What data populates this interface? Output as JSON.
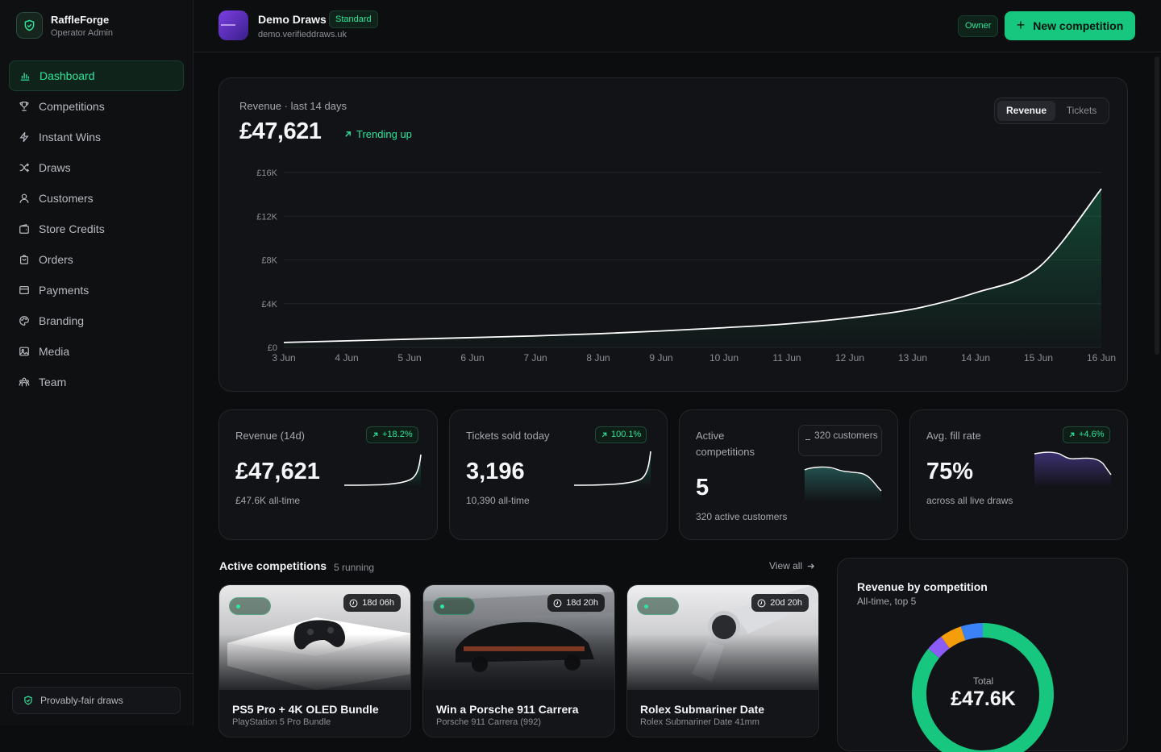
{
  "brand": {
    "name": "RaffleForge",
    "role": "Operator Admin"
  },
  "nav": [
    {
      "label": "Dashboard",
      "icon": "bar-chart-icon",
      "active": true
    },
    {
      "label": "Competitions",
      "icon": "trophy-icon"
    },
    {
      "label": "Instant Wins",
      "icon": "lightning-icon"
    },
    {
      "label": "Draws",
      "icon": "shuffle-icon"
    },
    {
      "label": "Customers",
      "icon": "user-icon"
    },
    {
      "label": "Store Credits",
      "icon": "wallet-icon"
    },
    {
      "label": "Orders",
      "icon": "bag-icon"
    },
    {
      "label": "Payments",
      "icon": "card-icon"
    },
    {
      "label": "Branding",
      "icon": "palette-icon"
    },
    {
      "label": "Media",
      "icon": "image-icon"
    },
    {
      "label": "Team",
      "icon": "team-icon"
    }
  ],
  "footer": {
    "badge": "Provably-fair draws"
  },
  "org": {
    "name": "Demo Draws",
    "plan": "Standard",
    "url": "demo.verifieddraws.uk",
    "role": "Owner"
  },
  "actions": {
    "new_competition": "New competition"
  },
  "revenue_chart": {
    "title": "Revenue · last 14 days",
    "total": "£47,621",
    "trend": "Trending up",
    "toggle": {
      "active": "Revenue",
      "inactive": "Tickets"
    }
  },
  "chart_data": {
    "type": "area",
    "title": "Revenue · last 14 days",
    "x": [
      "3 Jun",
      "4 Jun",
      "5 Jun",
      "6 Jun",
      "7 Jun",
      "8 Jun",
      "9 Jun",
      "10 Jun",
      "11 Jun",
      "12 Jun",
      "13 Jun",
      "14 Jun",
      "15 Jun",
      "16 Jun"
    ],
    "series": [
      {
        "values": [
          450,
          600,
          750,
          900,
          1050,
          1250,
          1500,
          1800,
          2150,
          2700,
          3500,
          5000,
          7300,
          14500
        ]
      }
    ],
    "y_ticks": [
      "£0",
      "£4K",
      "£8K",
      "£12K",
      "£16K"
    ],
    "ylim": [
      0,
      16000
    ],
    "grid": true,
    "colors": {
      "line": "#ffffff",
      "fill": "#17c67f"
    }
  },
  "stats": [
    {
      "label": "Revenue (14d)",
      "delta": "+18.2%",
      "value": "£47,621",
      "sub": "£47.6K all-time"
    },
    {
      "label": "Tickets sold today",
      "delta": "100.1%",
      "value": "3,196",
      "sub": "10,390 all-time"
    },
    {
      "label": "Active competitions",
      "badge": "320 customers",
      "value": "5",
      "sub": "320 active customers"
    },
    {
      "label": "Avg. fill rate",
      "delta": "+4.6%",
      "value": "75%",
      "sub": "across all live draws"
    }
  ],
  "active_section": {
    "title": "Active competitions",
    "count": "5 running",
    "view_all": "View all"
  },
  "competitions": [
    {
      "title": "PS5 Pro + 4K OLED Bundle",
      "sub": "PlayStation 5 Pro Bundle",
      "time": "18d 06h"
    },
    {
      "title": "Win a Porsche 911 Carrera",
      "sub": "Porsche 911 Carrera (992)",
      "time": "18d 20h"
    },
    {
      "title": "Rolex Submariner Date",
      "sub": "Rolex Submariner Date 41mm",
      "time": "20d 20h"
    }
  ],
  "donut": {
    "title": "Revenue by competition",
    "sub": "All-time, top 5",
    "total_label": "Total",
    "total_value": "£47.6K",
    "segments": [
      {
        "share": 0.86,
        "color": "#17c67f"
      },
      {
        "share": 0.04,
        "color": "#8b5cf6"
      },
      {
        "share": 0.05,
        "color": "#f59e0b"
      },
      {
        "share": 0.05,
        "color": "#3b82f6"
      }
    ]
  }
}
